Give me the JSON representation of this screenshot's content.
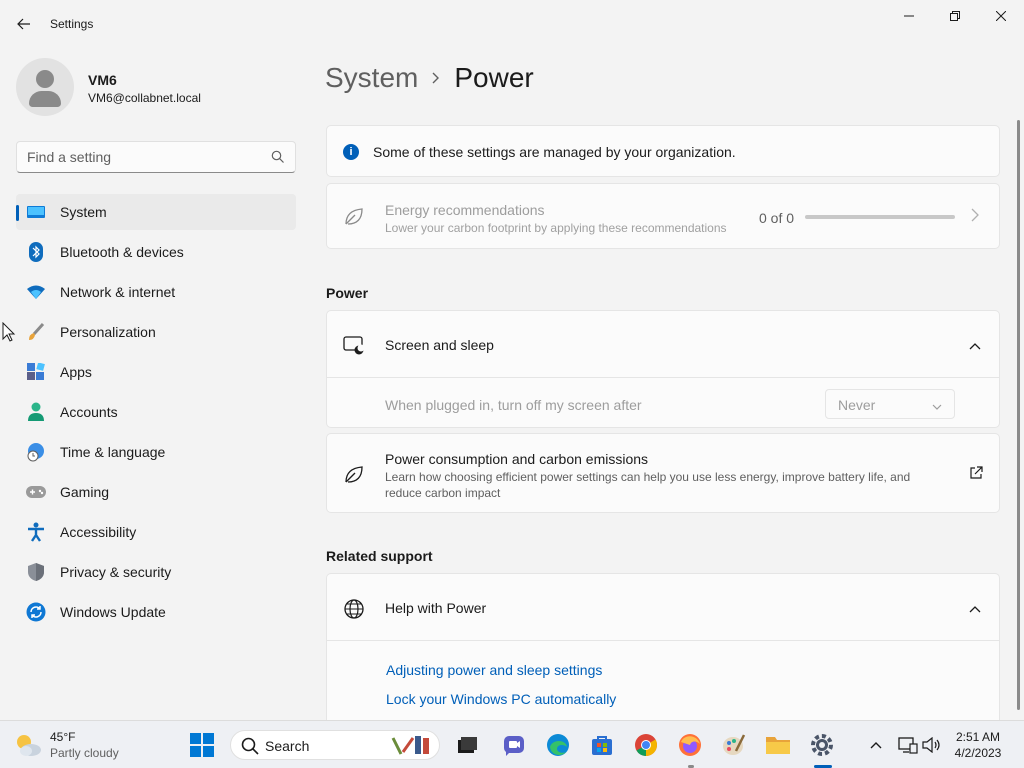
{
  "app": {
    "title": "Settings"
  },
  "profile": {
    "name": "VM6",
    "email": "VM6@collabnet.local"
  },
  "search": {
    "placeholder": "Find a setting"
  },
  "nav": {
    "items": [
      {
        "label": "System",
        "selected": true
      },
      {
        "label": "Bluetooth & devices"
      },
      {
        "label": "Network & internet"
      },
      {
        "label": "Personalization"
      },
      {
        "label": "Apps"
      },
      {
        "label": "Accounts"
      },
      {
        "label": "Time & language"
      },
      {
        "label": "Gaming"
      },
      {
        "label": "Accessibility"
      },
      {
        "label": "Privacy & security"
      },
      {
        "label": "Windows Update"
      }
    ]
  },
  "breadcrumb": {
    "parent": "System",
    "current": "Power"
  },
  "info": {
    "text": "Some of these settings are managed by your organization."
  },
  "energy": {
    "title": "Energy recommendations",
    "subtitle": "Lower your carbon footprint by applying these recommendations",
    "count": "0 of 0",
    "progress": 0
  },
  "power": {
    "section_title": "Power",
    "screen_sleep": {
      "title": "Screen and sleep",
      "row_label": "When plugged in, turn off my screen after",
      "value": "Never"
    },
    "consumption": {
      "title": "Power consumption and carbon emissions",
      "description": "Learn how choosing efficient power settings can help you use less energy, improve battery life, and reduce carbon impact"
    }
  },
  "support": {
    "section_title": "Related support",
    "help_title": "Help with Power",
    "links": [
      "Adjusting power and sleep settings",
      "Lock your Windows PC automatically"
    ]
  },
  "taskbar": {
    "weather": {
      "temp": "45°F",
      "desc": "Partly cloudy"
    },
    "search_label": "Search",
    "clock": {
      "time": "2:51 AM",
      "date": "4/2/2023"
    }
  },
  "colors": {
    "accent": "#005fb8",
    "background": "#f3f3f3",
    "card": "#fbfbfb"
  }
}
